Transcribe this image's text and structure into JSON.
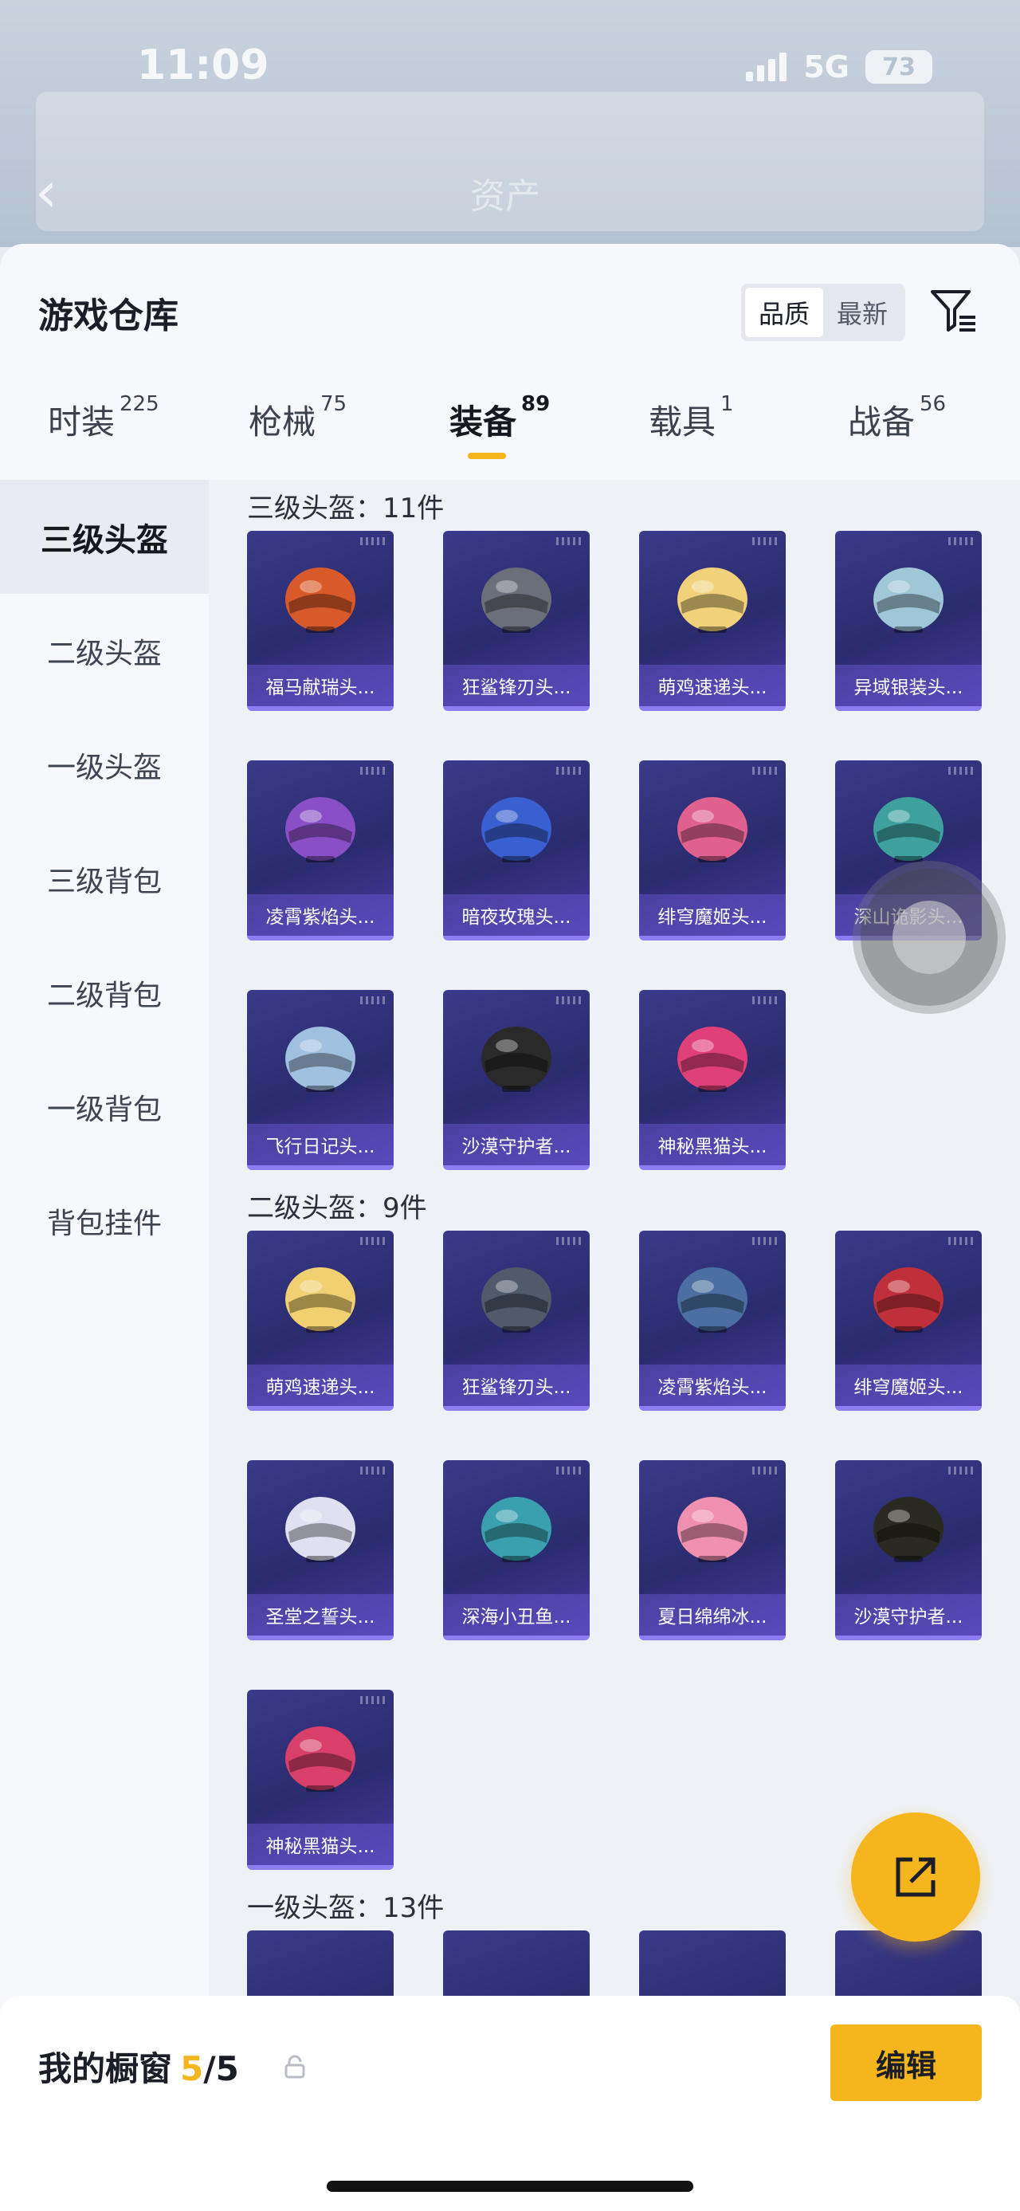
{
  "status": {
    "time": "11:09",
    "network": "5G",
    "battery": "73"
  },
  "background_page": {
    "title": "资产"
  },
  "header": {
    "title": "游戏仓库",
    "sort_options": [
      "品质",
      "最新"
    ],
    "sort_selected": "品质"
  },
  "tabs": [
    {
      "label": "时装",
      "count": "225"
    },
    {
      "label": "枪械",
      "count": "75"
    },
    {
      "label": "装备",
      "count": "89",
      "active": true
    },
    {
      "label": "载具",
      "count": "1"
    },
    {
      "label": "战备",
      "count": "56"
    }
  ],
  "side_categories": [
    "三级头盔",
    "二级头盔",
    "一级头盔",
    "三级背包",
    "二级背包",
    "一级背包",
    "背包挂件"
  ],
  "sections": [
    {
      "title": "三级头盔：11件",
      "items": [
        "福马献瑞头...",
        "狂鲨锋刃头...",
        "萌鸡速递头...",
        "异域银装头...",
        "凌霄紫焰头...",
        "暗夜玫瑰头...",
        "绯穹魔姬头...",
        "深山诡影头...",
        "飞行日记头...",
        "沙漠守护者...",
        "神秘黑猫头..."
      ]
    },
    {
      "title": "二级头盔：9件",
      "items": [
        "萌鸡速递头...",
        "狂鲨锋刃头...",
        "凌霄紫焰头...",
        "绯穹魔姬头...",
        "圣堂之誓头...",
        "深海小丑鱼...",
        "夏日绵绵冰...",
        "沙漠守护者...",
        "神秘黑猫头..."
      ]
    },
    {
      "title": "一级头盔：13件",
      "items": []
    }
  ],
  "bottom": {
    "title": "我的橱窗",
    "count_current": "5",
    "count_total": "/5",
    "edit_label": "编辑"
  },
  "colors": {
    "accent": "#f5b51c",
    "card_bg": "#2b2b6e",
    "card_border": "#8d7cf2"
  },
  "icons": [
    "signal-icon",
    "battery-icon",
    "back-arrow-icon",
    "filter-icon",
    "share-icon",
    "lock-icon",
    "helmet-icon"
  ]
}
